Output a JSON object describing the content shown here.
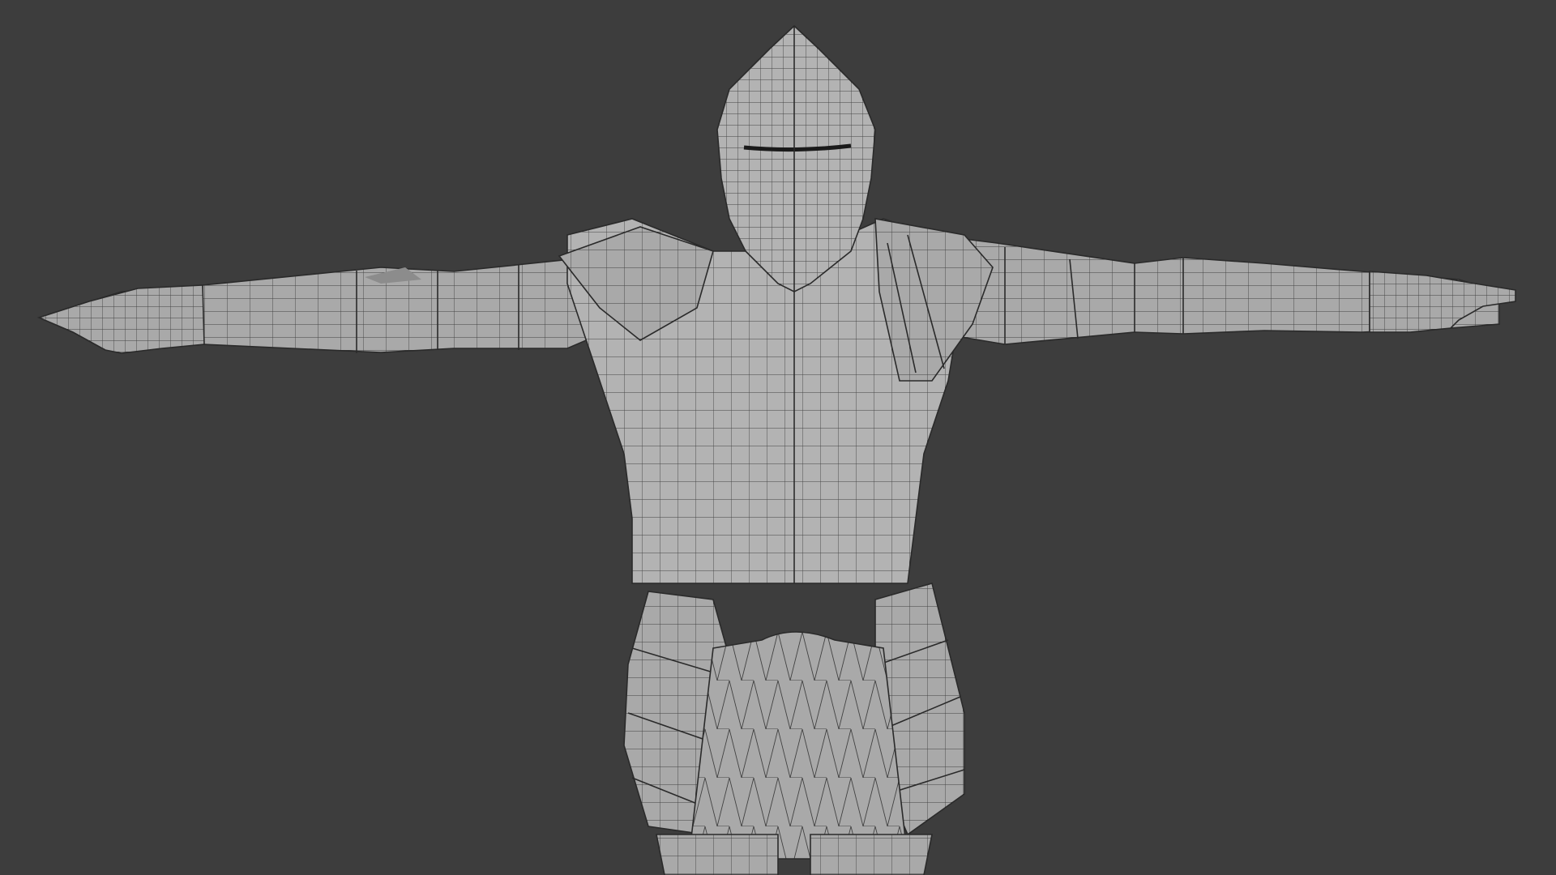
{
  "viewport": {
    "background_color": "#3d3d3d",
    "mode": "wireframe-overlay",
    "object": "knight-armor-mesh"
  },
  "model": {
    "surface_color": "#a9a9a9",
    "wire_color": "#2f2f2f",
    "pose": "T-pose"
  }
}
